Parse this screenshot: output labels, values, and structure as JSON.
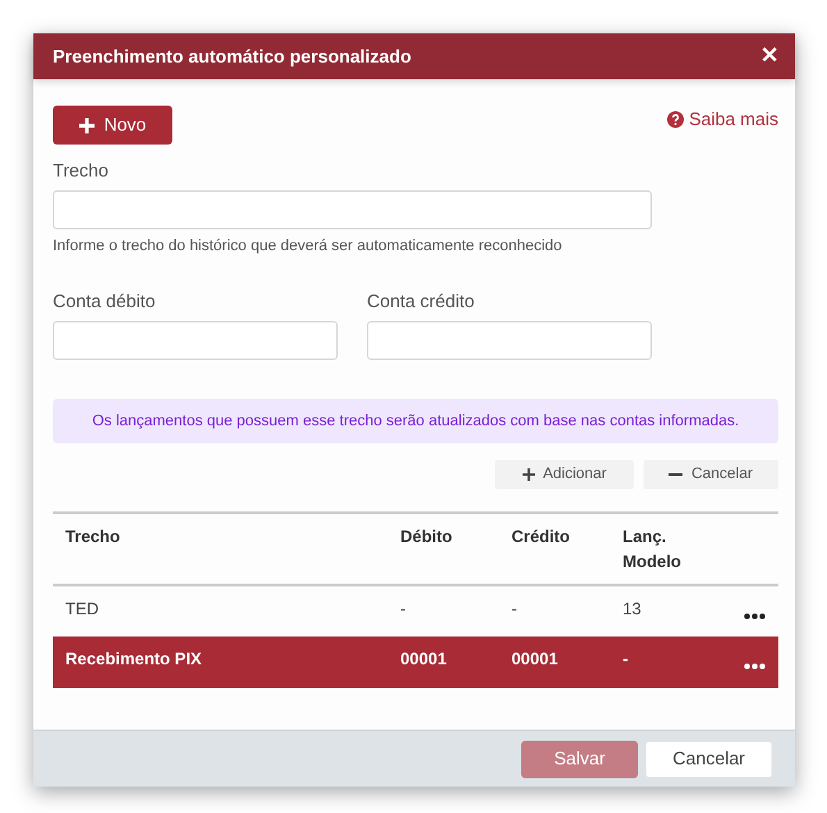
{
  "dialog": {
    "title": "Preenchimento automático personalizado",
    "close": "✕"
  },
  "new_button": {
    "label": "Novo"
  },
  "help_link": {
    "label": "Saiba mais"
  },
  "trecho_field": {
    "label": "Trecho",
    "hint": "Informe o trecho do histórico que deverá ser automaticamente reconhecido"
  },
  "account_fields": [
    {
      "label": "Conta débito"
    },
    {
      "label": "Conta crédito"
    }
  ],
  "info_alert": "Os lançamentos que possuem esse trecho serão atualizados com base nas contas informadas.",
  "row_actions": [
    {
      "kind": "add",
      "label": "Adicionar"
    },
    {
      "kind": "cancel",
      "label": "Cancelar"
    }
  ],
  "table": {
    "columns": [
      "Trecho",
      "Débito",
      "Crédito",
      "Lanç. Modelo"
    ],
    "rows": [
      {
        "cells": [
          "TED",
          "-",
          "-",
          "13"
        ],
        "selected": false
      },
      {
        "cells": [
          "Recebimento PIX",
          "00001",
          "00001",
          "-"
        ],
        "selected": true
      }
    ]
  },
  "footer_buttons": [
    {
      "kind": "primary",
      "label": "Salvar",
      "disabled": true
    },
    {
      "kind": "secondary",
      "label": "Cancelar",
      "disabled": false
    }
  ]
}
